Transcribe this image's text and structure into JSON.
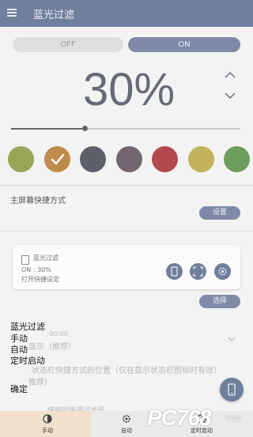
{
  "appbar": {
    "title": "蓝光过滤",
    "menu_icon": "hamburger-menu-icon"
  },
  "power": {
    "off_label": "OFF",
    "on_label": "ON",
    "selected": "ON"
  },
  "intensity": {
    "percent_text": "30%",
    "slider_fraction": 0.32
  },
  "colors": {
    "accent": "#6f7f9c",
    "swatches": [
      "#9aa557",
      "#bf8b4a",
      "#5d6068",
      "#6f676d",
      "#b3484f",
      "#c2b35d",
      "#6c9d5c"
    ],
    "selected_index": 1
  },
  "shortcut": {
    "section_label": "主屏幕快捷方式",
    "set_button": "设置",
    "card_title": "蓝光过滤",
    "card_status": "ON : 30%",
    "card_open_settings": "打开快捷设定",
    "card_icons": [
      "phone-icon",
      "fullscreen-icon",
      "gear-icon"
    ],
    "select_button": "选择"
  },
  "background_fragments": {
    "notification_fragment": "-00:00",
    "display_fragment": "显示（推荐）",
    "statusbar_position_label": "状态栏快捷方式的位置（仅在显示状态栏图标时有效）",
    "recommended_fragment": "推荐）",
    "bottom_fragment": "使用时接通过滤器"
  },
  "overlay_menu": {
    "title": "蓝光过滤",
    "items": [
      "手动",
      "自动",
      "定时启动"
    ],
    "confirm": "确定"
  },
  "bottom_nav": {
    "items": [
      {
        "label": "手动",
        "icon": "manual-icon",
        "active": true
      },
      {
        "label": "自动",
        "icon": "auto-gear-icon",
        "active": false
      },
      {
        "label": "定时启动",
        "icon": "timer-icon",
        "active": false
      }
    ]
  },
  "watermark": {
    "main": "PC768",
    "sub": "下载站"
  }
}
